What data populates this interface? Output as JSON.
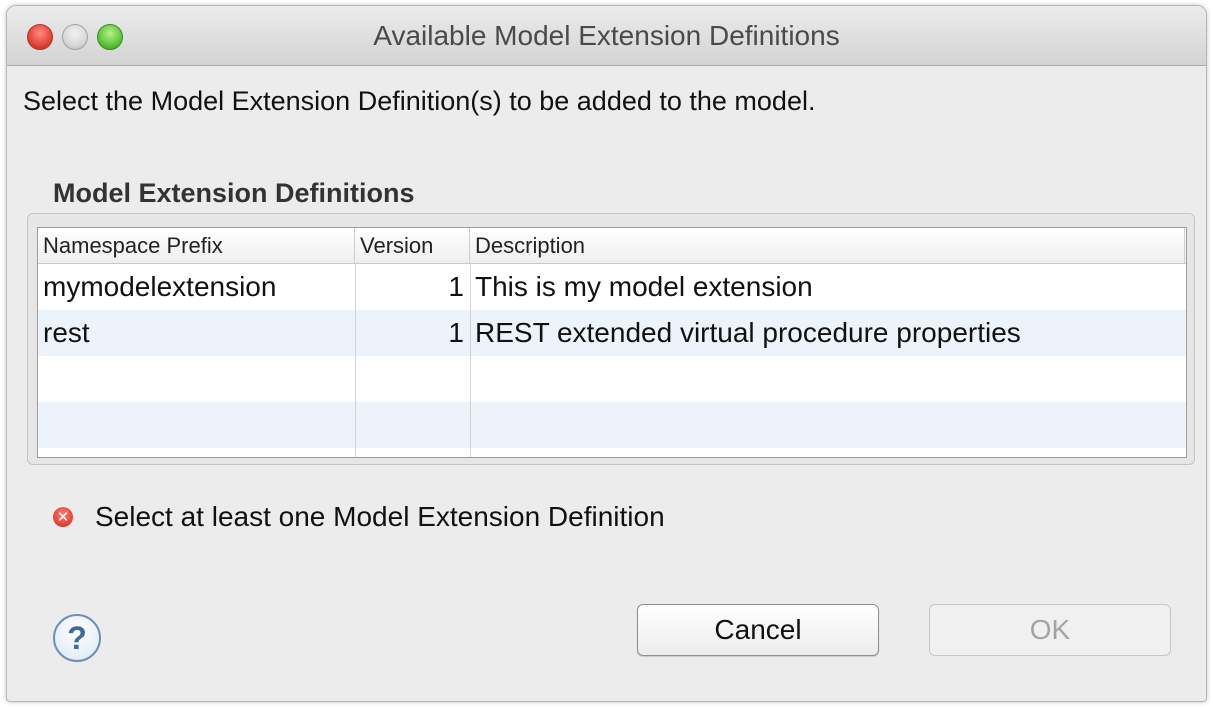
{
  "window": {
    "title": "Available Model Extension Definitions"
  },
  "instruction": "Select the Model Extension Definition(s) to be added to the model.",
  "group": {
    "label": "Model Extension Definitions"
  },
  "table": {
    "columns": [
      "Namespace Prefix",
      "Version",
      "Description"
    ],
    "rows": [
      {
        "prefix": "mymodelextension",
        "version": "1",
        "description": "This is my model extension"
      },
      {
        "prefix": "rest",
        "version": "1",
        "description": "REST extended virtual procedure properties"
      }
    ]
  },
  "error": {
    "icon": "error-icon",
    "message": "Select at least one Model Extension Definition"
  },
  "help": {
    "glyph": "?"
  },
  "buttons": {
    "cancel": "Cancel",
    "ok": "OK"
  }
}
